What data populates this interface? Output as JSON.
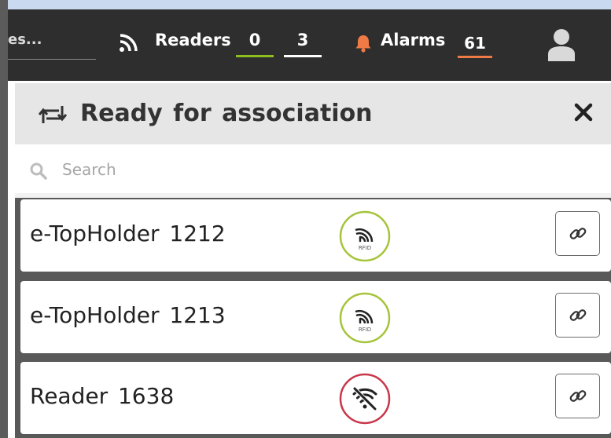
{
  "colors": {
    "topbar_bg": "#2e2e2e",
    "readers_online_underline": "#8dbd1f",
    "readers_total_underline": "#ffffff",
    "alarm_accent": "#f07a45",
    "rfid_ok": "#a5c43a",
    "rfid_offline": "#c8374a"
  },
  "topbar": {
    "search_partial_text": "es...",
    "readers_icon": "rss-icon",
    "readers_label": "Readers",
    "readers_online": "0",
    "readers_total": "3",
    "alarms_icon": "bell-icon",
    "alarms_label": "Alarms",
    "alarms_count": "61",
    "user_icon": "user-icon"
  },
  "panel": {
    "title_icon": "swap-icon",
    "title": "Ready for association",
    "close_icon": "close-icon",
    "search_icon": "search-icon",
    "search_placeholder": "Search",
    "search_value": "",
    "items": [
      {
        "name": "e-TopHolder 1212",
        "status": "rfid-ok",
        "status_icon": "rfid-icon",
        "action_icon": "link-icon"
      },
      {
        "name": "e-TopHolder 1213",
        "status": "rfid-ok",
        "status_icon": "rfid-icon",
        "action_icon": "link-icon"
      },
      {
        "name": "Reader 1638",
        "status": "offline",
        "status_icon": "wifi-off-icon",
        "action_icon": "link-icon"
      }
    ]
  }
}
